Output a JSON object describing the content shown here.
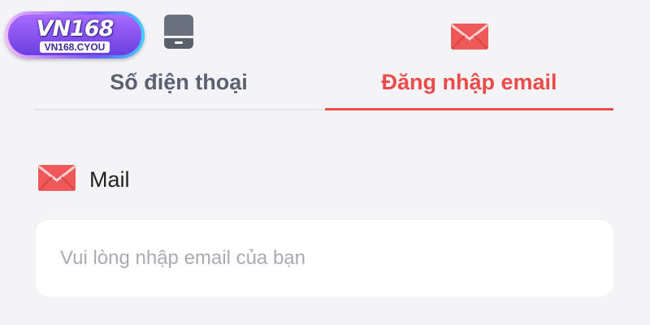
{
  "logo": {
    "title": "VN168",
    "subtitle": "VN168.CYOU"
  },
  "tabs": [
    {
      "label": "Số điện thoại",
      "icon": "phone-icon",
      "active": false
    },
    {
      "label": "Đăng nhập email",
      "icon": "mail-icon",
      "active": true
    }
  ],
  "form": {
    "email_label": "Mail",
    "email_label_icon": "mail-icon",
    "email_value": "",
    "email_placeholder": "Vui lòng nhập email của bạn"
  },
  "colors": {
    "accent": "#ea4b4b",
    "inactive_tab_text": "#5a6170",
    "background": "#f4f4f7",
    "input_background": "#ffffff",
    "placeholder": "#a9abb3"
  }
}
